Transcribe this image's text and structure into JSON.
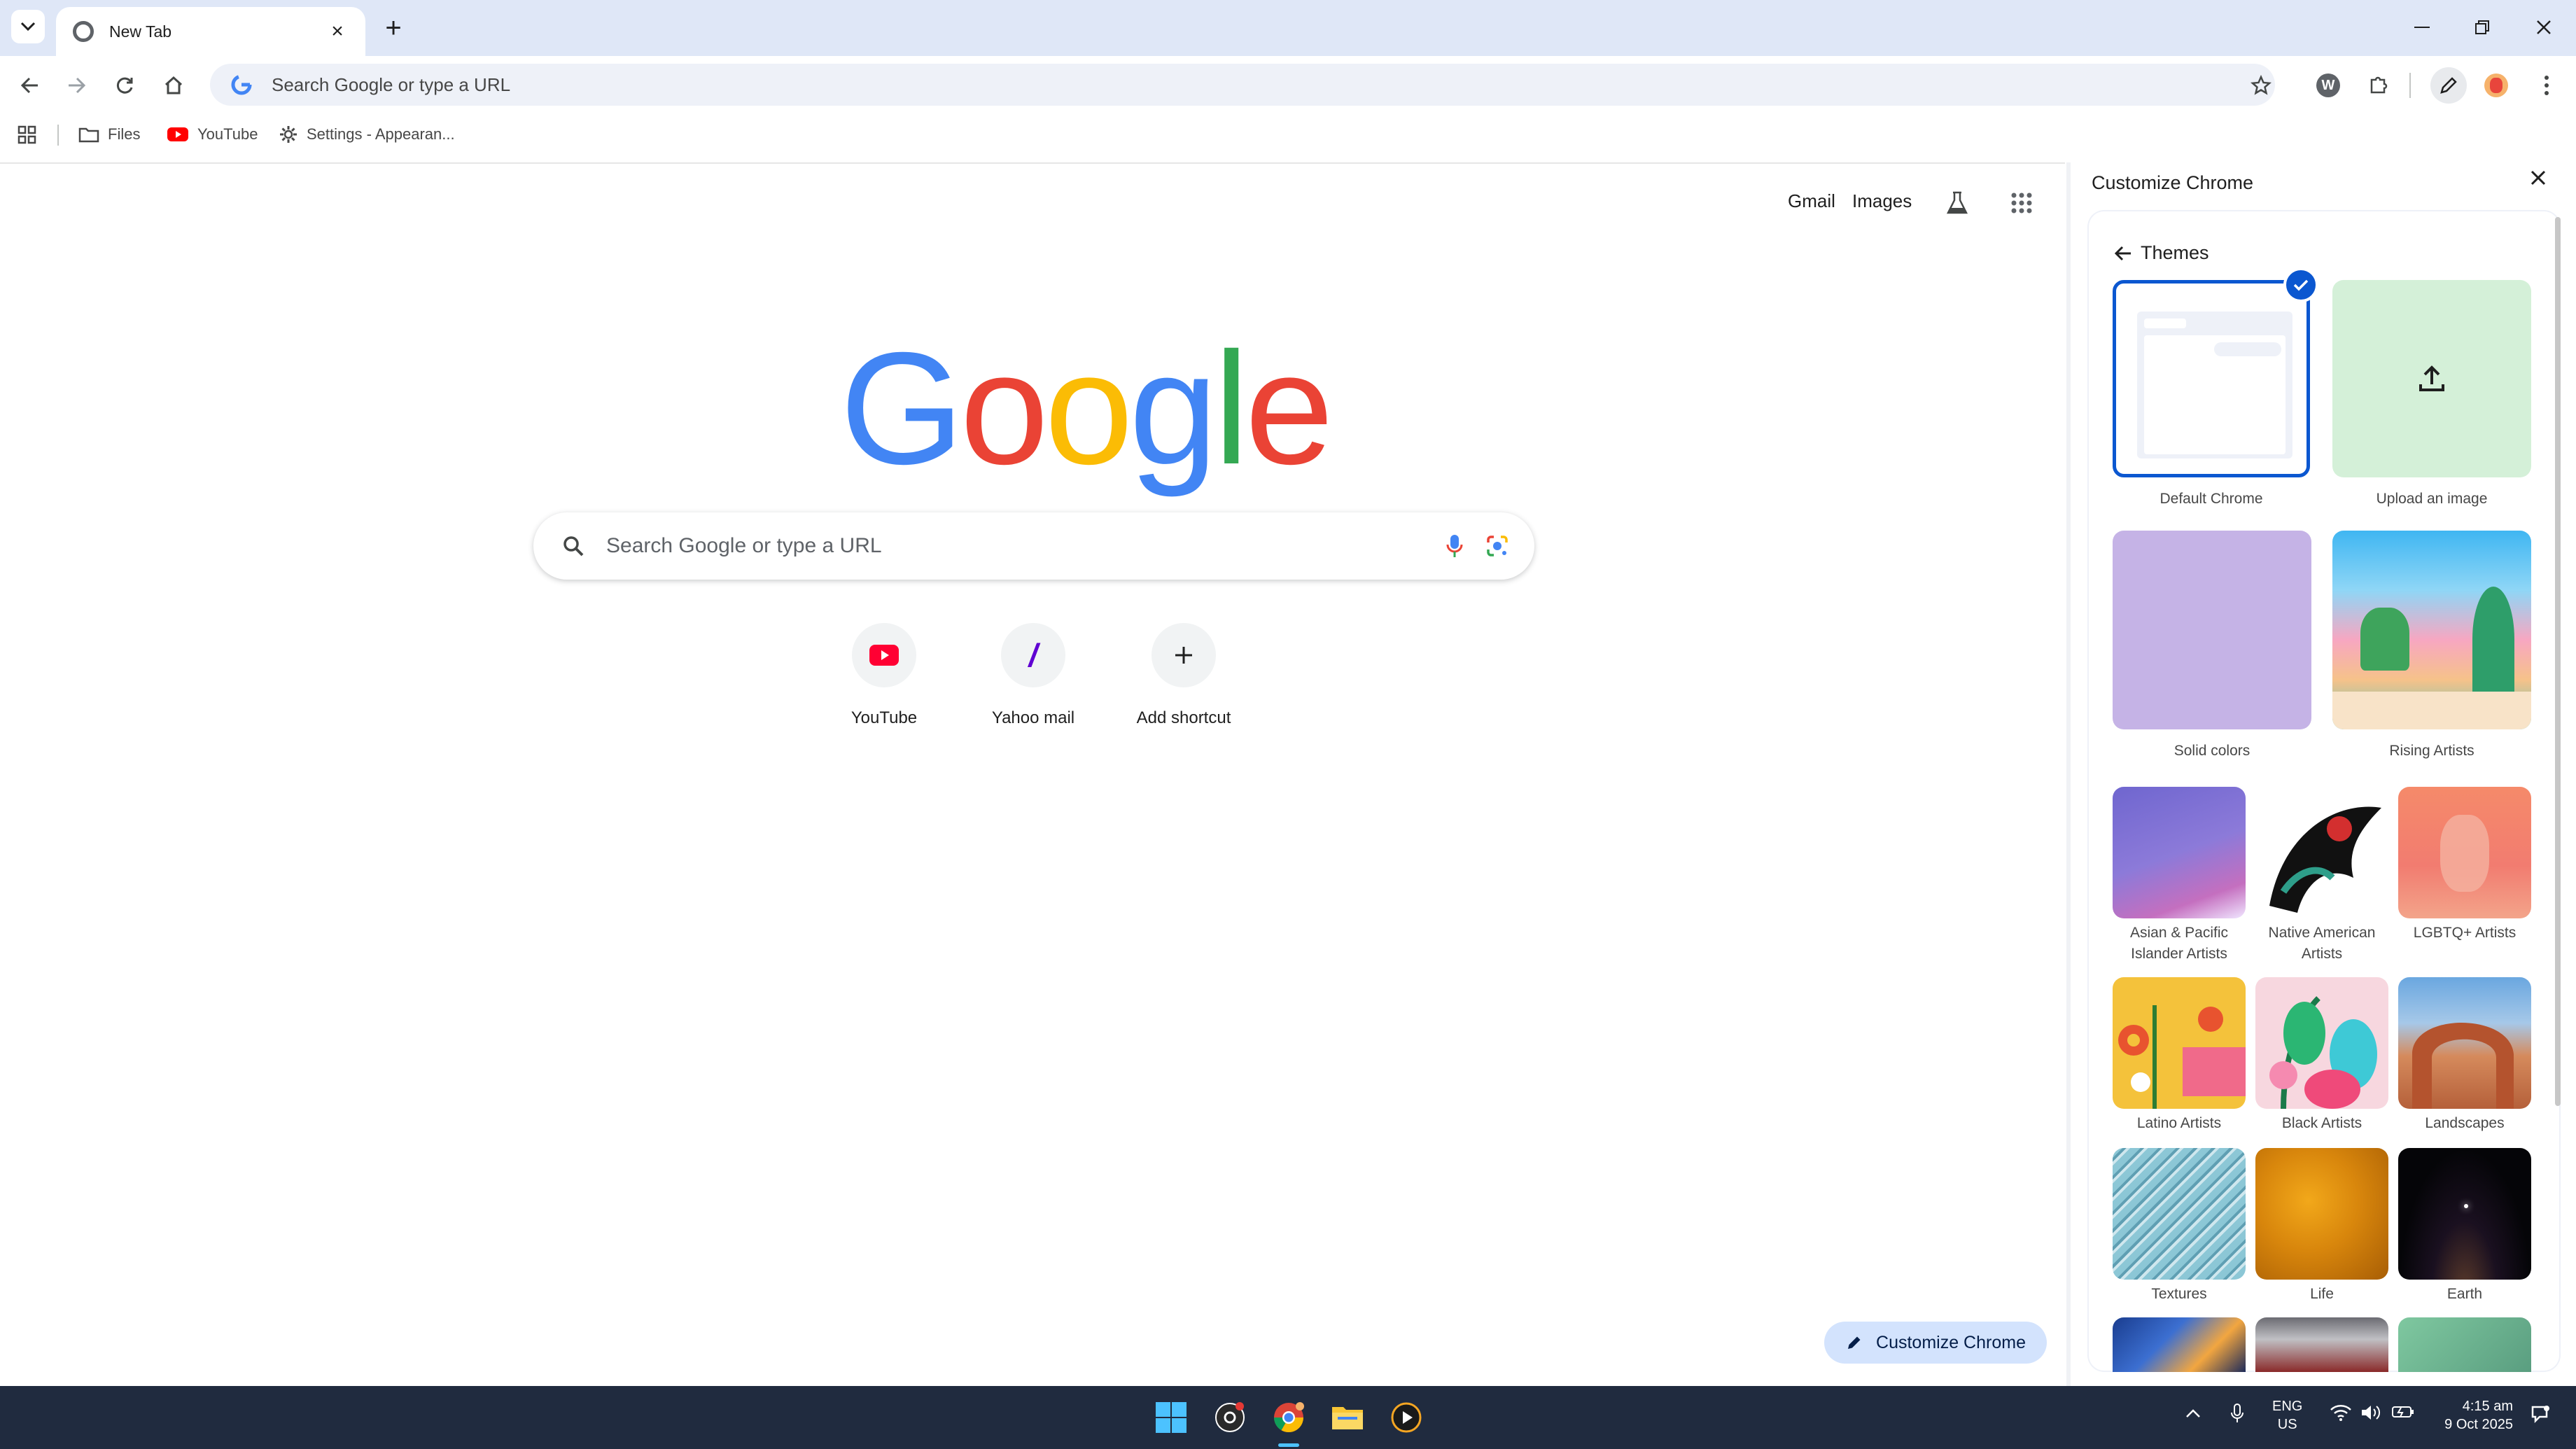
{
  "browser": {
    "tab_title": "New Tab",
    "omnibox_placeholder": "Search Google or type a URL"
  },
  "bookmarks": [
    {
      "label": "Files",
      "icon": "folder-icon"
    },
    {
      "label": "YouTube",
      "icon": "youtube-icon"
    },
    {
      "label": "Settings - Appearan...",
      "icon": "gear-icon"
    }
  ],
  "ntp": {
    "links": {
      "gmail": "Gmail",
      "images": "Images"
    },
    "logo": "Google",
    "search_placeholder": "Search Google or type a URL",
    "shortcuts": [
      {
        "label": "YouTube",
        "icon": "youtube-icon"
      },
      {
        "label": "Yahoo mail",
        "icon": "yahoo-icon"
      },
      {
        "label": "Add shortcut",
        "icon": "plus-icon"
      }
    ],
    "customize_button": "Customize Chrome"
  },
  "panel": {
    "title": "Customize Chrome",
    "section": "Themes",
    "themes_large": [
      {
        "label": "Default Chrome",
        "selected": true,
        "color": "#ffffff"
      },
      {
        "label": "Upload an image",
        "color": "#d4f0d8"
      },
      {
        "label": "Solid colors",
        "color": "#c5b3e6"
      },
      {
        "label": "Rising Artists",
        "color": "#f0a0b8"
      }
    ],
    "themes_small": [
      {
        "label": "Asian & Pacific Islander Artists",
        "label_lines": [
          "Asian & Pacific",
          "Islander Artists"
        ],
        "color": "#7b6fd0"
      },
      {
        "label": "Native American Artists",
        "label_lines": [
          "Native American",
          "Artists"
        ],
        "color": "#ffffff"
      },
      {
        "label": "LGBTQ+ Artists",
        "label_lines": [
          "LGBTQ+ Artists"
        ],
        "color": "#f28a6f"
      },
      {
        "label": "Latino Artists",
        "label_lines": [
          "Latino Artists"
        ],
        "color": "#f4c23b"
      },
      {
        "label": "Black Artists",
        "label_lines": [
          "Black Artists"
        ],
        "color": "#f4a6b8"
      },
      {
        "label": "Landscapes",
        "label_lines": [
          "Landscapes"
        ],
        "color": "#c0683c"
      },
      {
        "label": "Textures",
        "label_lines": [
          "Textures"
        ],
        "color": "#7fb8c7"
      },
      {
        "label": "Life",
        "label_lines": [
          "Life"
        ],
        "color": "#d88a10"
      },
      {
        "label": "Earth",
        "label_lines": [
          "Earth"
        ],
        "color": "#0b0b14"
      }
    ]
  },
  "taskbar": {
    "lang_top": "ENG",
    "lang_bottom": "US",
    "time": "4:15 am",
    "date": "9 Oct 2025"
  },
  "colors": {
    "accent": "#0b57d0",
    "tabstrip": "#dfe7f7",
    "taskbar": "#202b3f",
    "customize_button": "#d3e3fd"
  }
}
